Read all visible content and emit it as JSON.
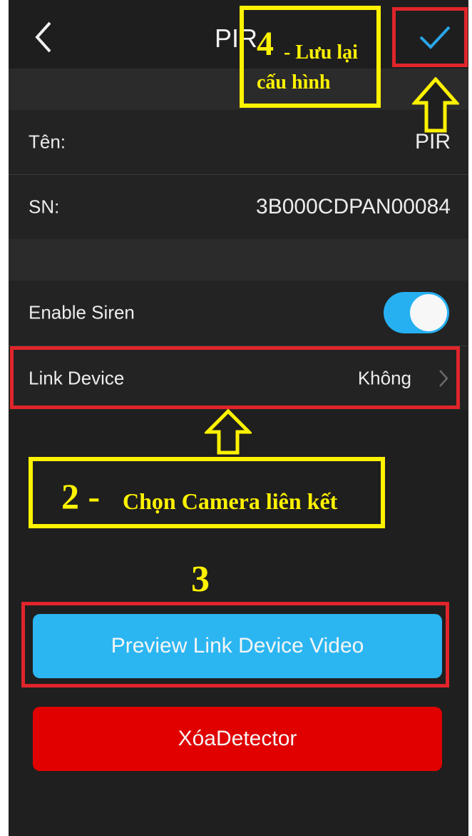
{
  "header": {
    "title": "PIR",
    "back_icon": "chevron-left-icon",
    "confirm_icon": "checkmark-icon"
  },
  "device": {
    "name_label": "Tên:",
    "name_value": "PIR",
    "sn_label": "SN:",
    "sn_value": "3B000CDPAN00084"
  },
  "settings": {
    "siren_label": "Enable Siren",
    "siren_on": true,
    "link_label": "Link Device",
    "link_value": "Không"
  },
  "buttons": {
    "preview": "Preview Link Device Video",
    "delete": "XóaDetector"
  },
  "annotations": {
    "step4_number": "4",
    "step4_text_line1": "- Lưu lại",
    "step4_text_line2": "cấu hình",
    "step2_number": "2 -",
    "step2_text": "Chọn Camera liên kết",
    "step3_number": "3"
  },
  "colors": {
    "accent": "#2bb6f2",
    "danger": "#e00000",
    "highlight_red": "#e0252b",
    "highlight_yellow": "#fff200"
  }
}
